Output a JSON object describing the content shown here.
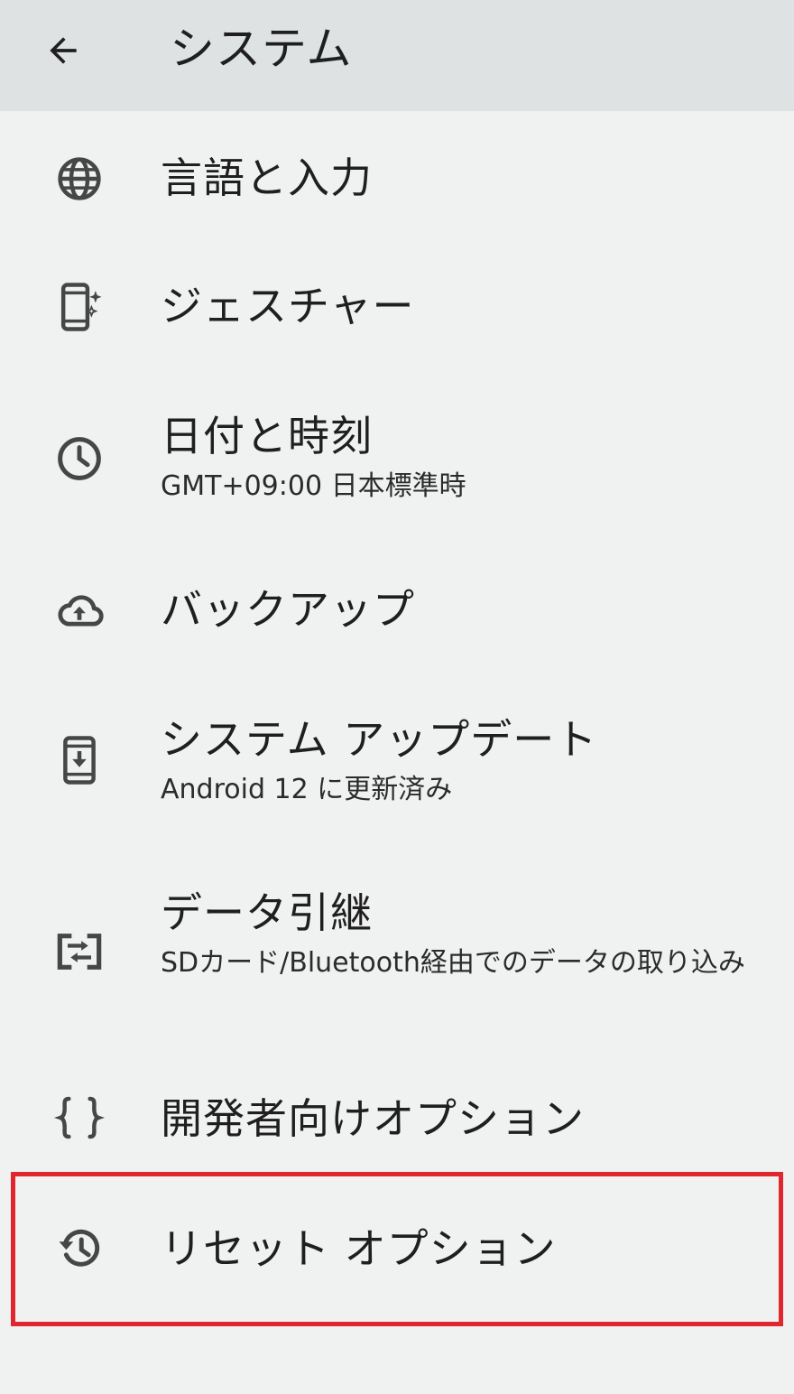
{
  "appbar": {
    "title": "システム",
    "back_icon": "arrow-back-icon"
  },
  "items": [
    {
      "title": "言語と入力",
      "summary": "",
      "icon": "globe-icon"
    },
    {
      "title": "ジェスチャー",
      "summary": "",
      "icon": "gesture-phone-icon"
    },
    {
      "title": "日付と時刻",
      "summary": "GMT+09:00 日本標準時",
      "icon": "clock-icon"
    },
    {
      "title": "バックアップ",
      "summary": "",
      "icon": "cloud-upload-icon"
    },
    {
      "title": "システム アップデート",
      "summary": "Android 12 に更新済み",
      "icon": "system-update-icon"
    },
    {
      "title": "データ引継",
      "summary": "SDカード/Bluetooth経由でのデータの取り込み",
      "icon": "data-transfer-icon"
    },
    {
      "title": "開発者向けオプション",
      "summary": "",
      "icon": "braces-icon"
    },
    {
      "title": "リセット オプション",
      "summary": "",
      "icon": "restore-history-icon"
    }
  ],
  "colors": {
    "background": "#f0f1f1",
    "appbar": "#dfe2e2",
    "icon": "#444746",
    "highlight_border": "#e0262e"
  }
}
